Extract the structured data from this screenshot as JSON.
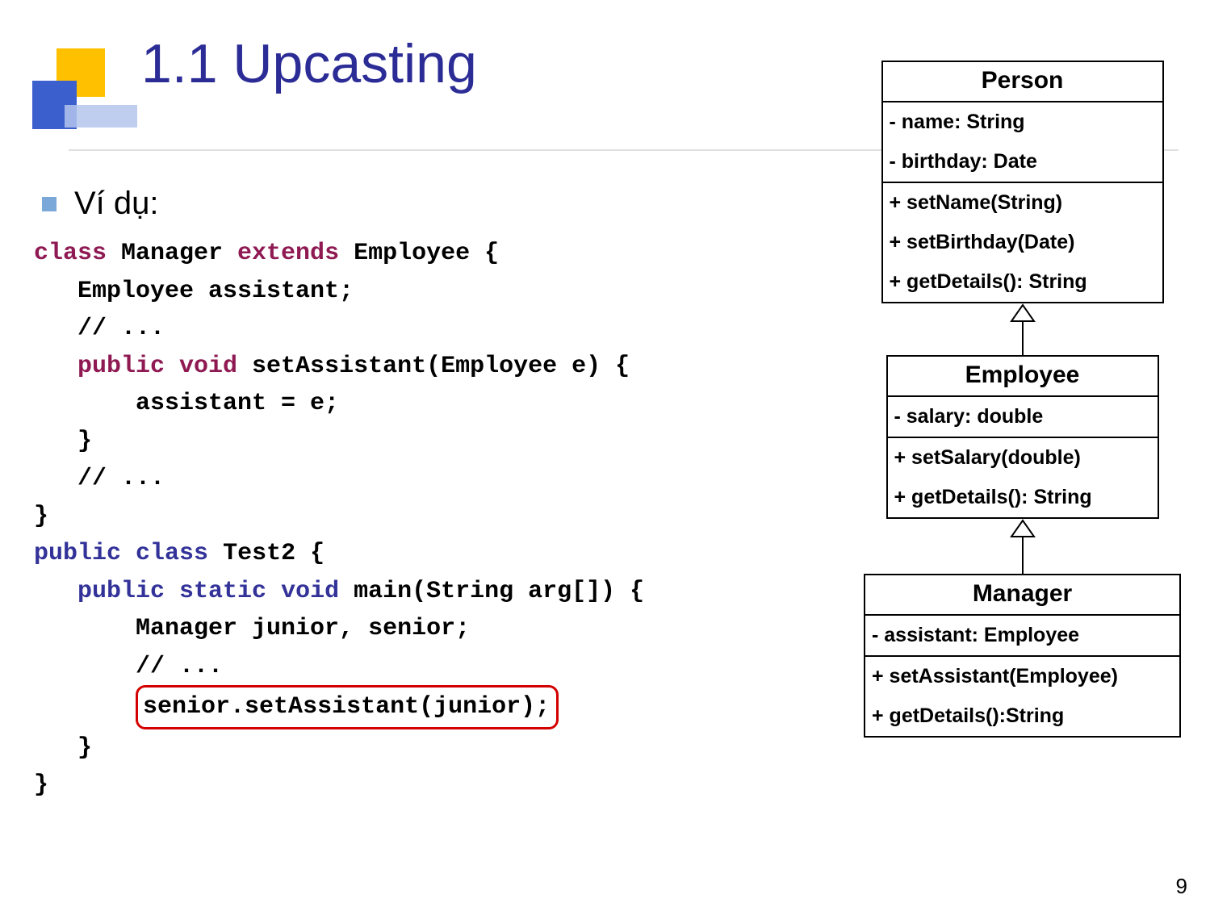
{
  "title": "1.1 Upcasting",
  "bullet": "Ví dụ:",
  "code": {
    "l1a": "class",
    "l1b": " Manager ",
    "l1c": "extends",
    "l1d": " Employee {",
    "l2": "   Employee assistant;",
    "l3": "   // ...",
    "l4a": "   public",
    "l4b": " void",
    "l4c": " setAssistant(Employee e) {",
    "l5": "       assistant = e;",
    "l6": "   }",
    "l7": "   // ...",
    "l8": "}",
    "l9a": "public",
    "l9b": " class",
    "l9c": " Test2 {",
    "l10a": "   public",
    "l10b": " static",
    "l10c": " void",
    "l10d": " main(String arg[]) {",
    "l11": "       Manager junior, senior;",
    "l12": "       // ...",
    "l13pad": "       ",
    "l13": "senior.setAssistant(junior);",
    "l14": "   }",
    "l15": "}"
  },
  "uml": {
    "person": {
      "name": "Person",
      "attrs": [
        "- name: String",
        "- birthday: Date"
      ],
      "methods": [
        "+ setName(String)",
        "+ setBirthday(Date)",
        "+ getDetails(): String"
      ]
    },
    "employee": {
      "name": "Employee",
      "attrs": [
        "- salary: double"
      ],
      "methods": [
        "+ setSalary(double)",
        "+ getDetails(): String"
      ]
    },
    "manager": {
      "name": "Manager",
      "attrs": [
        "- assistant: Employee"
      ],
      "methods": [
        "+ setAssistant(Employee)",
        "+ getDetails():String"
      ]
    }
  },
  "page_number": "9"
}
